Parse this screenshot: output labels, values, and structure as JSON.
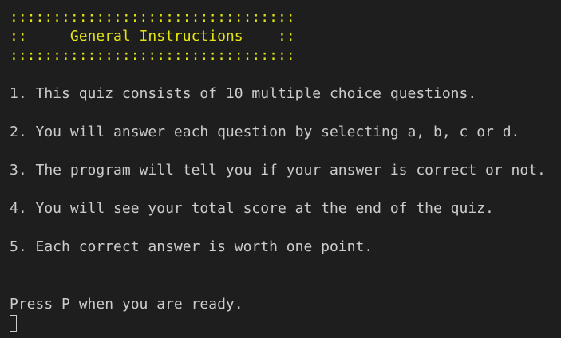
{
  "header": {
    "border_top": ":::::::::::::::::::::::::::::::::",
    "title_line": "::     General Instructions    ::",
    "border_bottom": ":::::::::::::::::::::::::::::::::"
  },
  "instructions": [
    "1. This quiz consists of 10 multiple choice questions.",
    "2. You will answer each question by selecting a, b, c or d.",
    "3. The program will tell you if your answer is correct or not.",
    "4. You will see your total score at the end of the quiz.",
    "5. Each correct answer is worth one point."
  ],
  "prompt": "Press P when you are ready.",
  "colors": {
    "background": "#1e1e1e",
    "text": "#cccccc",
    "header": "#e5e510"
  }
}
